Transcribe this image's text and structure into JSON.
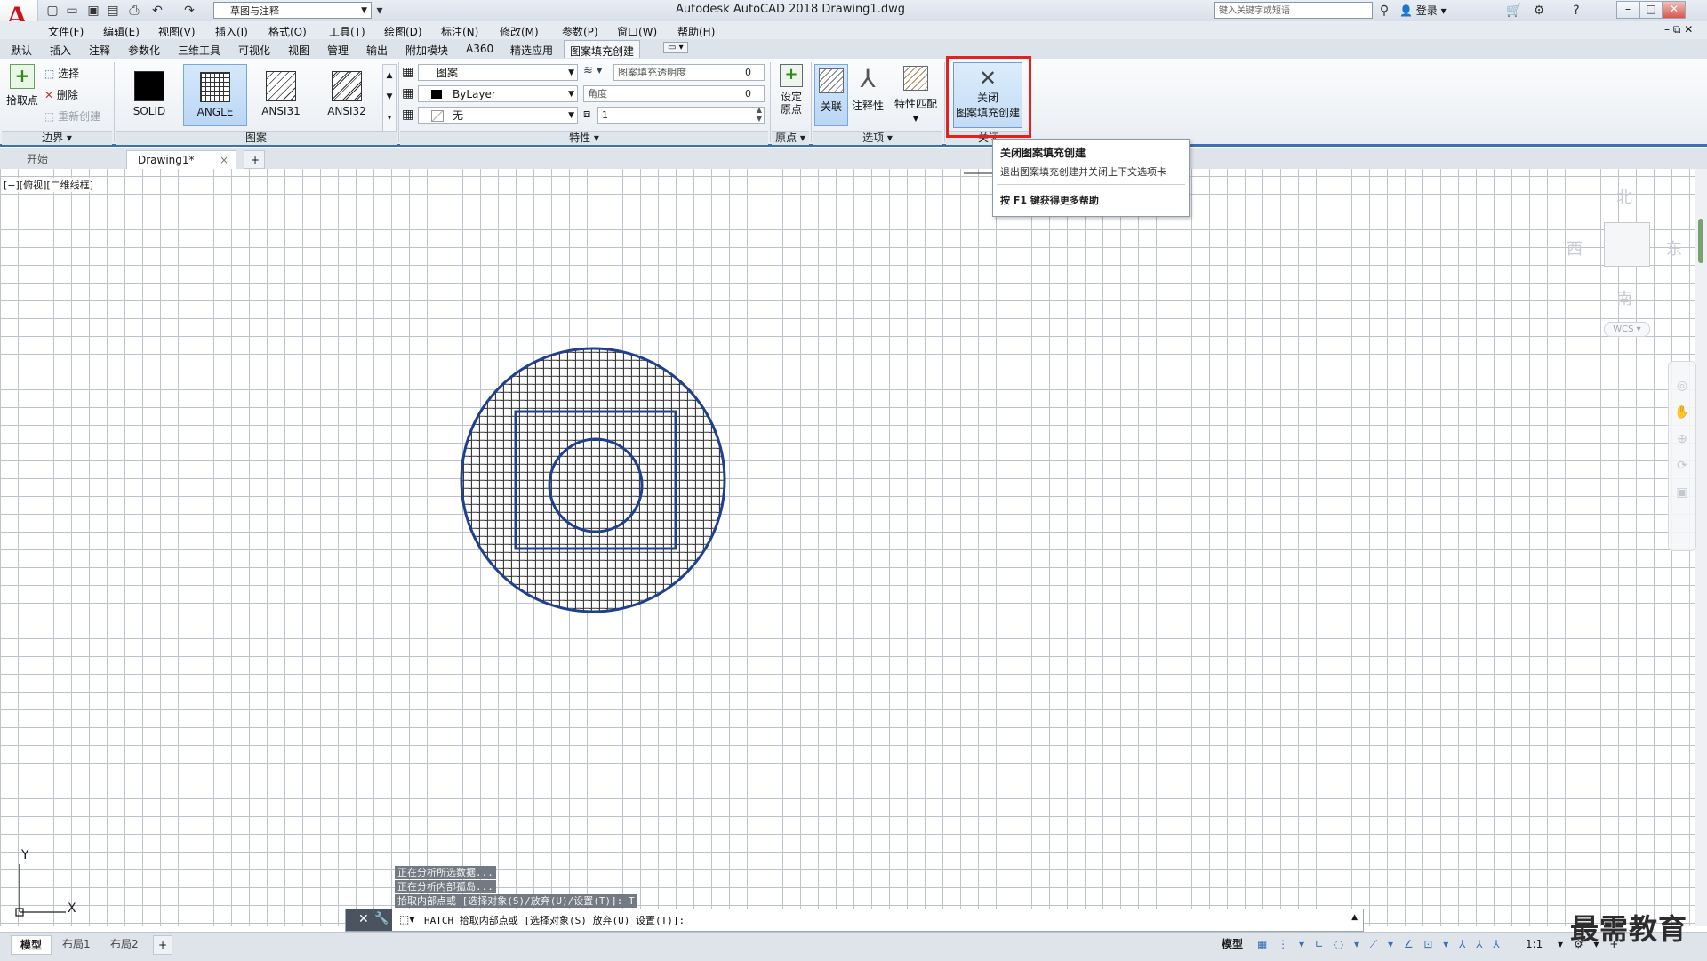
{
  "app": {
    "title": "Autodesk AutoCAD 2018    Drawing1.dwg",
    "workspace": "草图与注释",
    "search_placeholder": "键入关键字或短语",
    "login": "登录"
  },
  "menu": [
    "文件(F)",
    "编辑(E)",
    "视图(V)",
    "插入(I)",
    "格式(O)",
    "工具(T)",
    "绘图(D)",
    "标注(N)",
    "修改(M)",
    "参数(P)",
    "窗口(W)",
    "帮助(H)"
  ],
  "ribbon_tabs": [
    "默认",
    "插入",
    "注释",
    "参数化",
    "三维工具",
    "可视化",
    "视图",
    "管理",
    "输出",
    "附加模块",
    "A360",
    "精选应用",
    "图案填充创建"
  ],
  "ribbon": {
    "boundary": {
      "pick_point": "拾取点",
      "select": "选择",
      "remove": "删除",
      "recreate": "重新创建",
      "title": "边界"
    },
    "pattern": {
      "swatches": [
        "SOLID",
        "ANGLE",
        "ANSI31",
        "ANSI32"
      ],
      "title": "图案"
    },
    "properties": {
      "type": "图案",
      "color": "ByLayer",
      "background": "无",
      "transparency_label": "图案填充透明度",
      "transparency_value": "0",
      "angle_label": "角度",
      "angle_value": "0",
      "scale_value": "1",
      "title": "特性"
    },
    "origin": {
      "set_origin": "设定原点",
      "title": "原点"
    },
    "options": {
      "associative": "关联",
      "annotative": "注释性",
      "match_properties": "特性匹配",
      "title": "选项"
    },
    "close": {
      "label_line1": "关闭",
      "label_line2": "图案填充创建",
      "title": "关闭"
    }
  },
  "tooltip": {
    "title": "关闭图案填充创建",
    "description": "退出图案填充创建并关闭上下文选项卡",
    "help": "按 F1 键获得更多帮助"
  },
  "file_tabs": [
    "开始",
    "Drawing1*"
  ],
  "view_label": "[−][俯视][二维线框]",
  "viewcube": {
    "north": "北",
    "south": "南",
    "east": "东",
    "west": "西",
    "wcs": "WCS"
  },
  "ucs": {
    "x": "X",
    "y": "Y"
  },
  "command_history": [
    "正在分析所选数据...",
    "正在分析内部孤岛...",
    "拾取内部点或 [选择对象(S)/放弃(U)/设置(T)]: T"
  ],
  "command_line": "HATCH 拾取内部点或 [选择对象(S) 放弃(U) 设置(T)]:",
  "layout_tabs": [
    "模型",
    "布局1",
    "布局2"
  ],
  "status": {
    "model": "模型",
    "scale": "1:1"
  },
  "watermark": "最需教育"
}
